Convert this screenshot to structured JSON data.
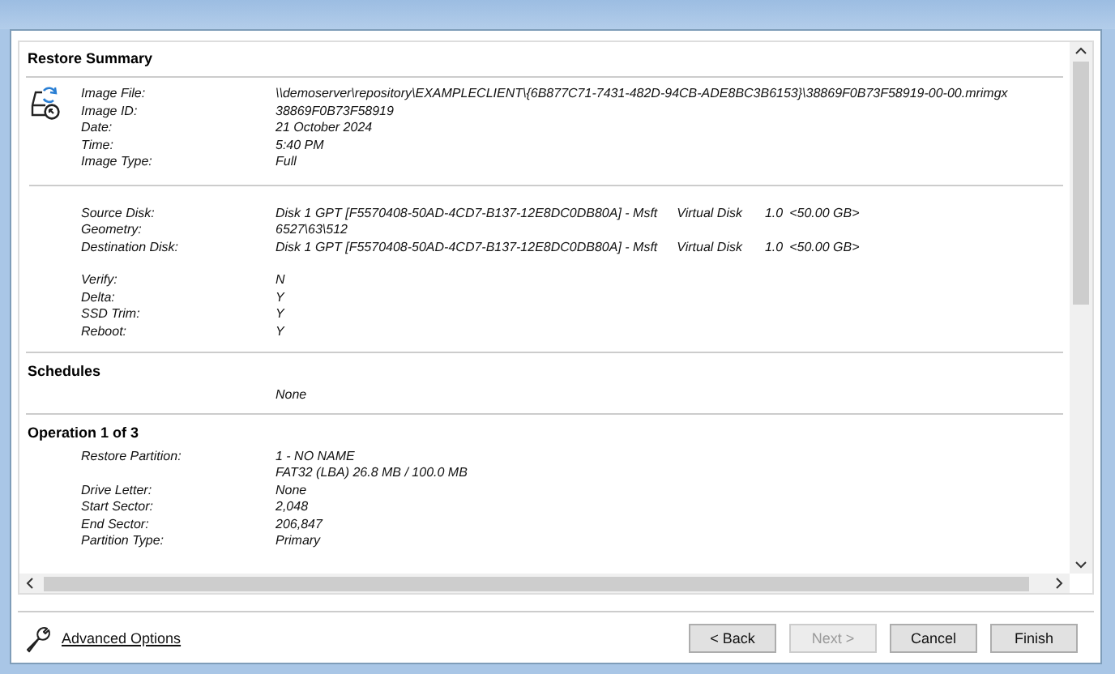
{
  "sections": [
    {
      "title": "Restore Summary",
      "kind": "image",
      "groups": [
        [
          {
            "label": "Image File:",
            "lines": [
              [
                "\\\\demoserver\\repository\\EXAMPLECLIENT\\{6B877C71-7431-482D-94CB-ADE8BC3B6153}\\38869F0B73F58919-00-00.mrimgx"
              ]
            ]
          },
          {
            "label": "Image ID:",
            "lines": [
              [
                "38869F0B73F58919"
              ]
            ]
          },
          {
            "label": "Date:",
            "lines": [
              [
                "21 October 2024"
              ]
            ]
          },
          {
            "label": "Time:",
            "lines": [
              [
                "5:40 PM"
              ]
            ]
          },
          {
            "label": "Image Type:",
            "lines": [
              [
                "Full"
              ]
            ]
          }
        ],
        [
          {
            "label": "Source Disk:",
            "lines": [
              [
                "Disk 1 GPT [F5570408-50AD-4CD7-B137-12E8DC0DB80A] - Msft",
                "Virtual Disk",
                "1.0",
                "<50.00 GB>"
              ]
            ]
          },
          {
            "label": "Geometry:",
            "lines": [
              [
                "6527\\63\\512"
              ]
            ]
          },
          {
            "label": "Destination Disk:",
            "lines": [
              [
                "Disk 1 GPT [F5570408-50AD-4CD7-B137-12E8DC0DB80A] - Msft",
                "Virtual Disk",
                "1.0",
                "<50.00 GB>"
              ]
            ]
          }
        ],
        [
          {
            "label": "Verify:",
            "lines": [
              [
                "N"
              ]
            ]
          },
          {
            "label": "Delta:",
            "lines": [
              [
                "Y"
              ]
            ]
          },
          {
            "label": "SSD Trim:",
            "lines": [
              [
                "Y"
              ]
            ]
          },
          {
            "label": "Reboot:",
            "lines": [
              [
                "Y"
              ]
            ]
          }
        ]
      ]
    },
    {
      "title": "Schedules",
      "kind": "plain",
      "groups": [
        [
          {
            "lines": [
              [
                "None"
              ]
            ]
          }
        ]
      ]
    },
    {
      "title": "Operation 1 of 3",
      "kind": "plain",
      "groups": [
        [
          {
            "label": "Restore Partition:",
            "lines": [
              [
                "1 - NO NAME"
              ],
              [
                "FAT32 (LBA) 26.8 MB / 100.0 MB"
              ]
            ]
          },
          {
            "label": "Drive Letter:",
            "lines": [
              [
                "None"
              ]
            ]
          },
          {
            "label": "Start Sector:",
            "lines": [
              [
                "2,048"
              ]
            ]
          },
          {
            "label": "End Sector:",
            "lines": [
              [
                "206,847"
              ]
            ]
          },
          {
            "label": "Partition Type:",
            "lines": [
              [
                "Primary"
              ]
            ]
          }
        ]
      ]
    }
  ],
  "advanced_link": "Advanced Options",
  "buttons": [
    {
      "label": "< Back",
      "disabled": false
    },
    {
      "label": "Next >",
      "disabled": true
    },
    {
      "label": "Cancel",
      "disabled": false
    },
    {
      "label": "Finish",
      "disabled": false
    }
  ]
}
